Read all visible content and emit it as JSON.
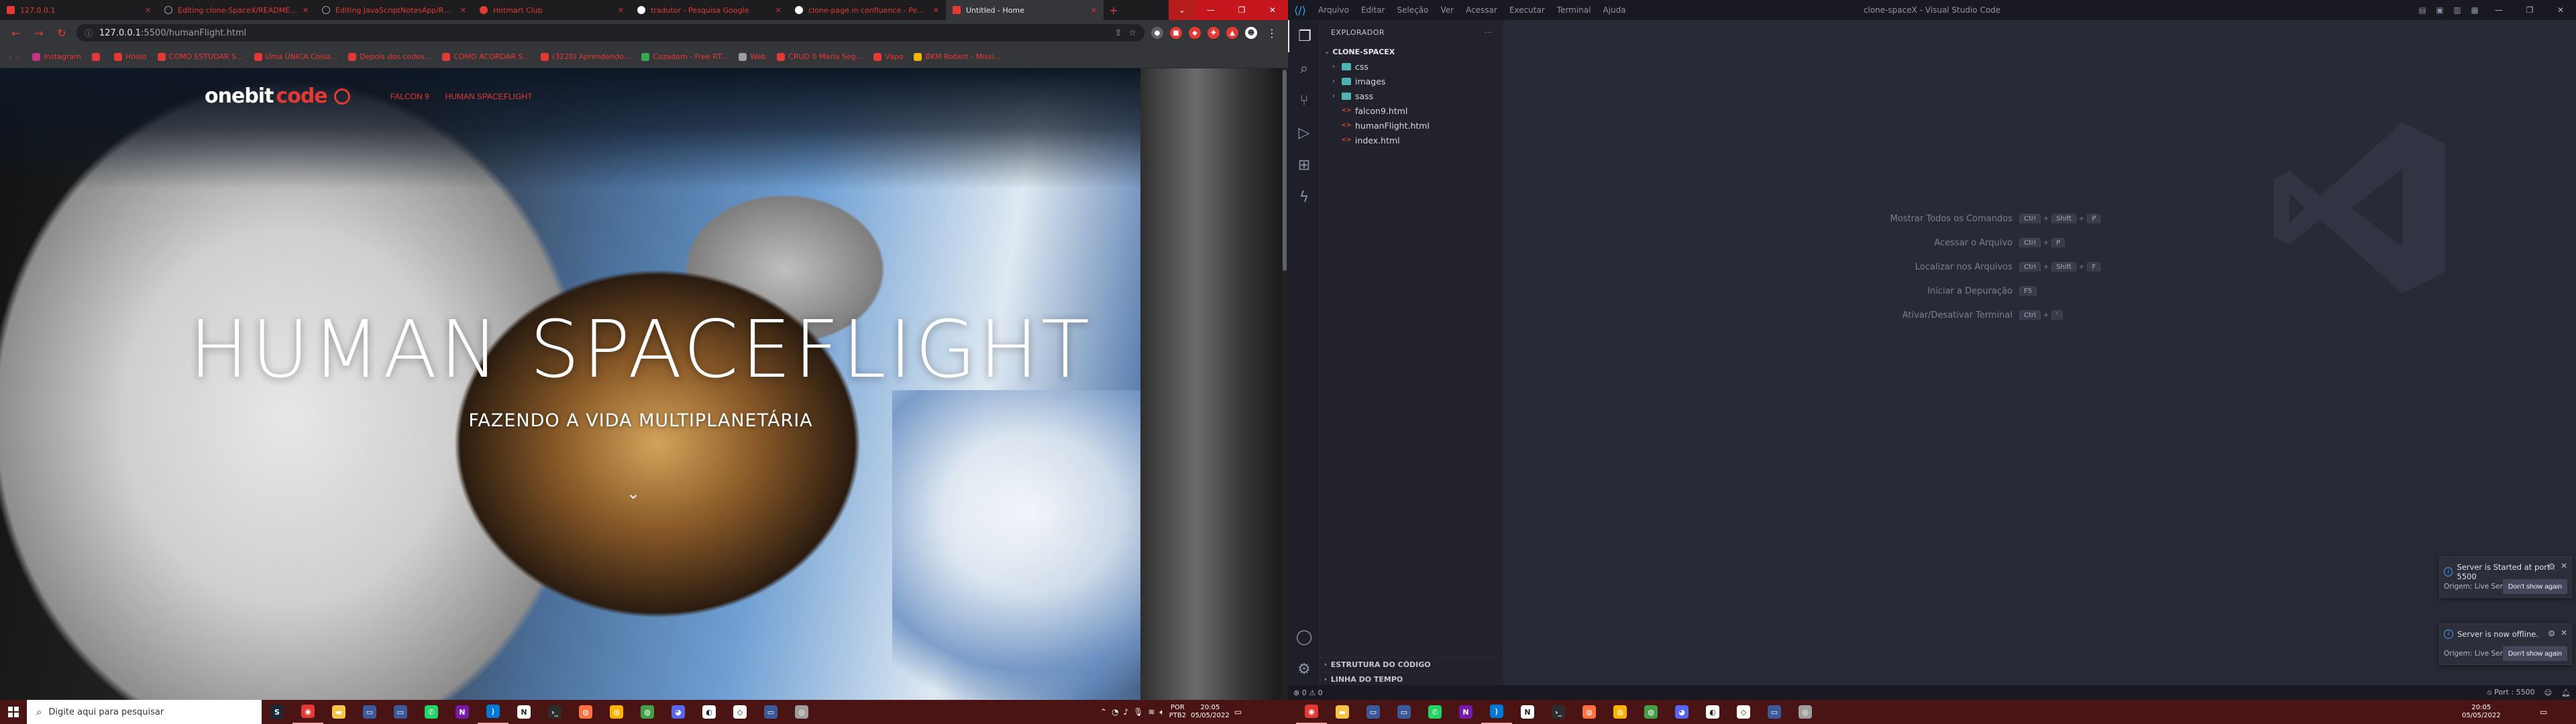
{
  "browser": {
    "tabs": [
      {
        "title": "127.0.0.1",
        "icon_color": "#e53935",
        "active": false
      },
      {
        "title": "Editing clone-SpaceX/README...",
        "icon_color": "#9aa0a6",
        "active": false
      },
      {
        "title": "Editing JavaScriptNotesApp/REA...",
        "icon_color": "#9aa0a6",
        "active": false
      },
      {
        "title": "Hotmart Club",
        "icon_color": "#e53935",
        "active": false
      },
      {
        "title": "tradutor - Pesquisa Google",
        "icon_color": "#ffffff",
        "active": false
      },
      {
        "title": "clone-page.in confluence - Pesq...",
        "icon_color": "#ffffff",
        "active": false
      },
      {
        "title": "Untitled - Home",
        "icon_color": "#e53935",
        "active": true
      }
    ],
    "url_host": "127.0.0.1",
    "url_path": ":5500/humanFlight.html",
    "bookmarks": [
      {
        "label": "Instagram",
        "color": "#c13584"
      },
      {
        "label": "",
        "color": "#e53935"
      },
      {
        "label": "Hoolo",
        "color": "#e53935"
      },
      {
        "label": "COMO ESTUDAR S...",
        "color": "#e53935"
      },
      {
        "label": "Uma ÚNICA Coisa...",
        "color": "#e53935"
      },
      {
        "label": "Depois dos codes...",
        "color": "#e53935"
      },
      {
        "label": "COMO ACORDAR S...",
        "color": "#e53935"
      },
      {
        "label": "(3220) Aprendendo...",
        "color": "#e53935"
      },
      {
        "label": "Cozadom - Free RT...",
        "color": "#34a853"
      },
      {
        "label": "Web",
        "color": "#9aa0a6"
      },
      {
        "label": "CRUD 0 Maria Seg...",
        "color": "#e53935"
      },
      {
        "label": "Vapo",
        "color": "#e53935"
      },
      {
        "label": "BKM Robert - Missi...",
        "color": "#f4b400"
      }
    ]
  },
  "site": {
    "logo_one": "onebit",
    "logo_code": "code",
    "nav": [
      "FALCON 9",
      "HUMAN SPACEFLIGHT"
    ],
    "hero_title": "HUMAN SPACEFLIGHT",
    "hero_subtitle": "FAZENDO A VIDA MULTIPLANETÁRIA"
  },
  "vscode": {
    "window_title": "clone-spaceX - Visual Studio Code",
    "menu": [
      "Arquivo",
      "Editar",
      "Seleção",
      "Ver",
      "Acessar",
      "Executar",
      "Terminal",
      "Ajuda"
    ],
    "explorer_title": "EXPLORADOR",
    "project": "CLONE-SPACEX",
    "tree": [
      {
        "name": "css",
        "type": "folder"
      },
      {
        "name": "images",
        "type": "folder"
      },
      {
        "name": "sass",
        "type": "folder"
      },
      {
        "name": "falcon9.html",
        "type": "html"
      },
      {
        "name": "humanFlight.html",
        "type": "html"
      },
      {
        "name": "index.html",
        "type": "html"
      }
    ],
    "outline": "ESTRUTURA DO CÓDIGO",
    "timeline": "LINHA DO TEMPO",
    "shortcuts": [
      {
        "label": "Mostrar Todos os Comandos",
        "keys": [
          "Ctrl",
          "Shift",
          "P"
        ]
      },
      {
        "label": "Acessar o Arquivo",
        "keys": [
          "Ctrl",
          "P"
        ]
      },
      {
        "label": "Localizar nos Arquivos",
        "keys": [
          "Ctrl",
          "Shift",
          "F"
        ]
      },
      {
        "label": "Iniciar a Depuração",
        "keys": [
          "F5"
        ]
      },
      {
        "label": "Ativar/Desativar Terminal",
        "keys": [
          "Ctrl",
          "'"
        ]
      }
    ],
    "toasts": [
      {
        "message": "Server is Started at port : 5500",
        "source": "Origem: Live Server (Extensão)",
        "button": "Don't show again"
      },
      {
        "message": "Server is now offline.",
        "source": "Origem: Live Server (Extensão)",
        "button": "Don't show again"
      }
    ],
    "status_errors": "0",
    "status_warnings": "0",
    "status_port": "Port : 5500"
  },
  "taskbar": {
    "search_placeholder": "Digite aqui para pesquisar",
    "lang_top": "POR",
    "lang_bottom": "PTB2",
    "time": "20:05",
    "date": "05/05/2022"
  }
}
